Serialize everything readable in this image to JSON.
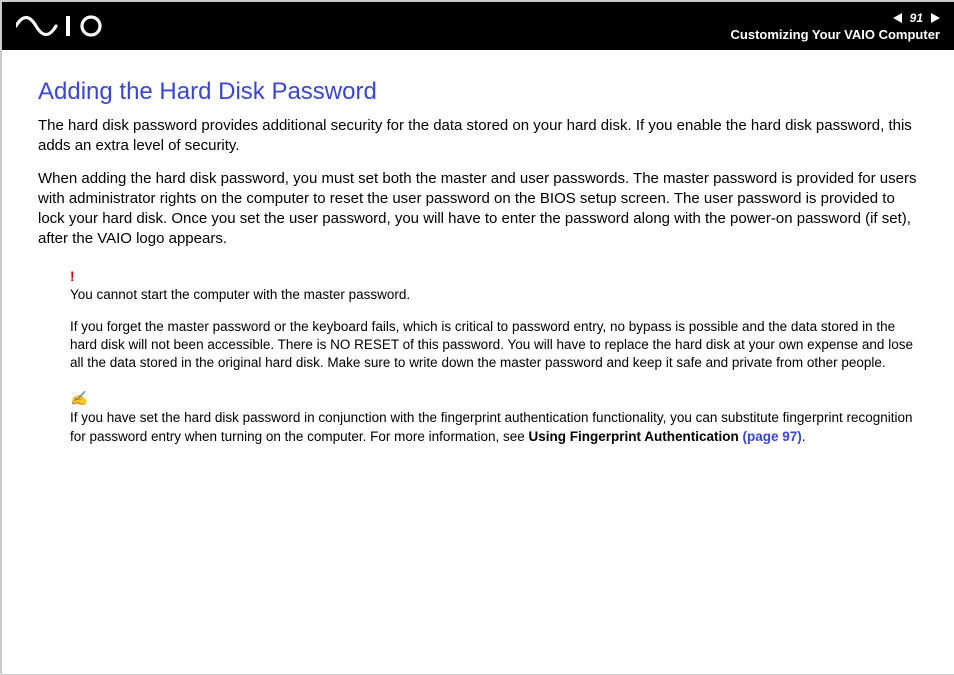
{
  "header": {
    "page_number": "91",
    "breadcrumb": "Customizing Your VAIO Computer"
  },
  "title": "Adding the Hard Disk Password",
  "paragraphs": [
    "The hard disk password provides additional security for the data stored on your hard disk. If you enable the hard disk password, this adds an extra level of security.",
    "When adding the hard disk password, you must set both the master and user passwords. The master password is provided for users with administrator rights on the computer to reset the user password on the BIOS setup screen. The user password is provided to lock your hard disk. Once you set the user password, you will have to enter the password along with the power-on password (if set), after the VAIO logo appears."
  ],
  "warning": {
    "mark": "!",
    "lines": [
      "You cannot start the computer with the master password.",
      "If you forget the master password or the keyboard fails, which is critical to password entry, no bypass is possible and the data stored in the hard disk will not been accessible. There is NO RESET of this password. You will have to replace the hard disk at your own expense and lose all the data stored in the original hard disk. Make sure to write down the master password and keep it safe and private from other people."
    ]
  },
  "tip": {
    "mark": "✍",
    "text": "If you have set the hard disk password in conjunction with the fingerprint authentication functionality, you can substitute fingerprint recognition for password entry when turning on the computer. For more information, see ",
    "xref_label": "Using Fingerprint Authentication ",
    "xref_link": "(page 97)",
    "tail": "."
  }
}
